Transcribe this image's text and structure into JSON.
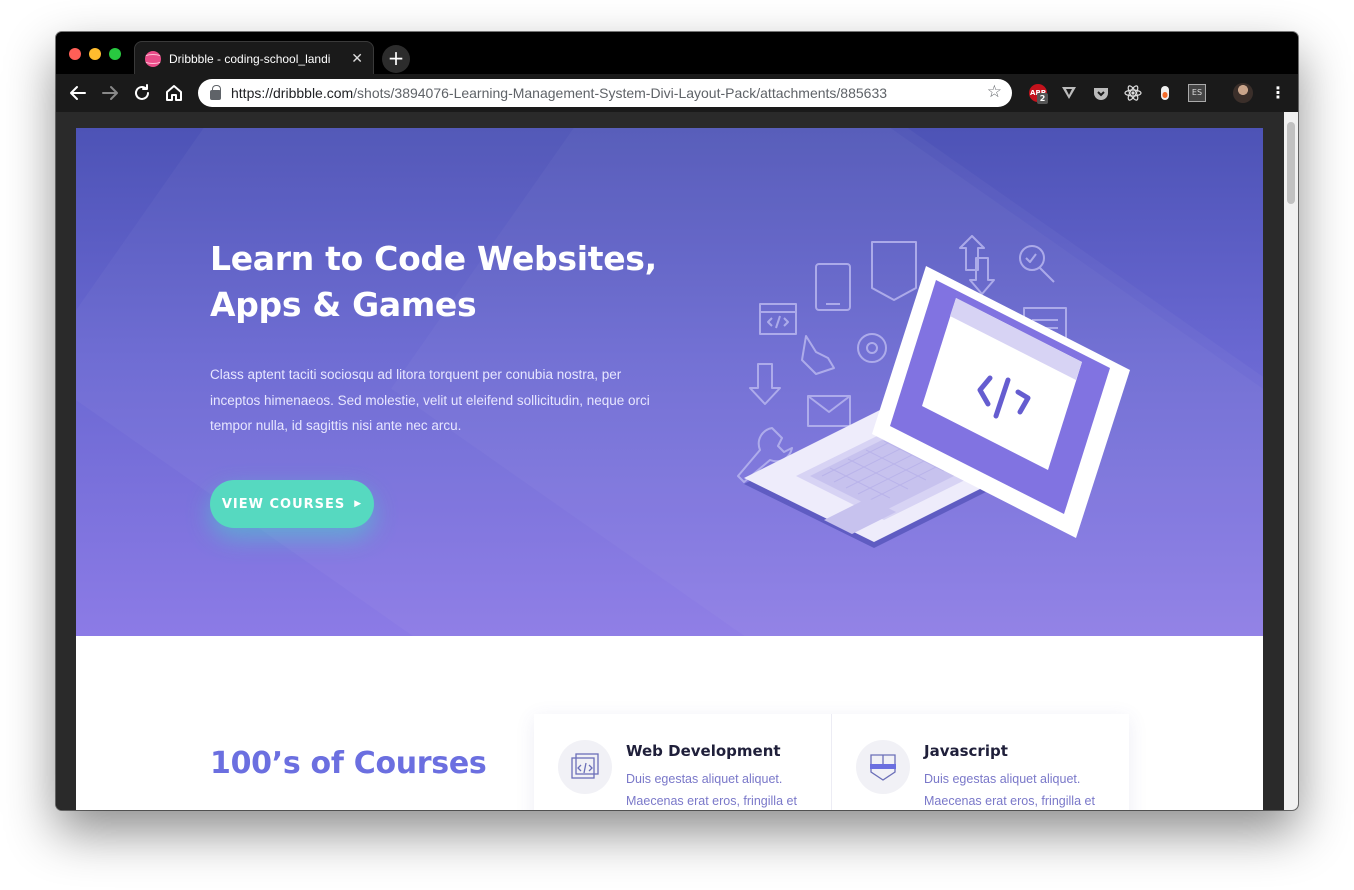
{
  "browser": {
    "tab_title": "Dribbble - coding-school_landi",
    "tab_close": "✕",
    "new_tab": "+",
    "url_host": "https://dribbble.com",
    "url_path": "/shots/3894076-Learning-Management-System-Divi-Layout-Pack/attachments/885633",
    "extensions": [
      "ABP",
      "V",
      "pocket",
      "react",
      "dropper",
      "ES"
    ],
    "abp_badge": "2",
    "es_label": "ES"
  },
  "hero": {
    "title_line1": "Learn to Code Websites,",
    "title_line2": "Apps & Games",
    "description": "Class aptent taciti sociosqu ad litora torquent per conubia nostra, per inceptos himenaeos. Sed molestie, velit ut eleifend sollicitudin, neque orci tempor nulla, id sagittis nisi ante nec arcu.",
    "cta_label": "VIEW COURSES",
    "cta_arrow": "▶"
  },
  "courses": {
    "section_title": "100’s of Courses",
    "cards": [
      {
        "title": "Web Development",
        "text": "Duis egestas aliquet aliquet. Maecenas erat eros, fringilla et",
        "icon": "code-window-icon"
      },
      {
        "title": "Javascript",
        "text": "Duis egestas aliquet aliquet. Maecenas erat eros, fringilla et",
        "icon": "shield-code-icon"
      }
    ]
  },
  "colors": {
    "hero_top": "#4d53b6",
    "hero_bottom": "#8c7be6",
    "accent": "#56d9c0",
    "section_title": "#6b6fe0"
  }
}
